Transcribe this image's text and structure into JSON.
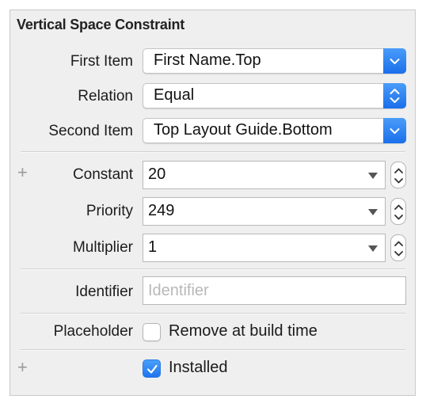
{
  "panel": {
    "title": "Vertical Space Constraint"
  },
  "first_item": {
    "label": "First Item",
    "value": "First Name.Top",
    "icon": "chevron-down-icon"
  },
  "relation": {
    "label": "Relation",
    "value": "Equal",
    "icon": "up-down-chevron-icon"
  },
  "second_item": {
    "label": "Second Item",
    "value": "Top Layout Guide.Bottom",
    "icon": "chevron-down-icon"
  },
  "constant": {
    "label": "Constant",
    "value": "20",
    "add_icon": "plus-icon"
  },
  "priority": {
    "label": "Priority",
    "value": "249"
  },
  "multiplier": {
    "label": "Multiplier",
    "value": "1"
  },
  "identifier": {
    "label": "Identifier",
    "value": "",
    "placeholder": "Identifier"
  },
  "placeholder_option": {
    "label": "Placeholder",
    "checkbox_label": "Remove at build time",
    "checked": false
  },
  "installed": {
    "checkbox_label": "Installed",
    "checked": true,
    "add_icon": "plus-icon"
  },
  "colors": {
    "accent": "#2a7ff0",
    "panel_bg": "#efefef",
    "border": "#c9c9c9"
  }
}
